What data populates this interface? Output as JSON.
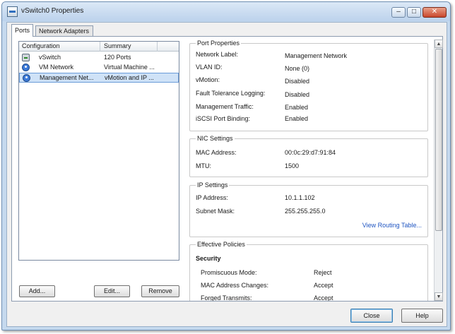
{
  "window": {
    "title": "vSwitch0 Properties"
  },
  "title_buttons": {
    "minimize": "–",
    "maximize": "□",
    "close": "✕"
  },
  "tabs": [
    "Ports",
    "Network Adapters"
  ],
  "list": {
    "columns": [
      "Configuration",
      "Summary"
    ],
    "rows": [
      {
        "name": "vSwitch",
        "summary": "120 Ports",
        "icon": "vswitch-icon"
      },
      {
        "name": "VM Network",
        "summary": "Virtual Machine ...",
        "icon": "network-icon"
      },
      {
        "name": "Management Net...",
        "summary": "vMotion and IP ...",
        "icon": "network-icon",
        "selected": true
      }
    ]
  },
  "list_buttons": {
    "add": "Add...",
    "edit": "Edit...",
    "remove": "Remove"
  },
  "port_properties": {
    "title": "Port Properties",
    "rows": [
      {
        "label": "Network Label:",
        "value": "Management Network"
      },
      {
        "label": "VLAN ID:",
        "value": "None (0)"
      },
      {
        "label": "vMotion:",
        "value": "Disabled"
      },
      {
        "label": "Fault Tolerance Logging:",
        "value": "Disabled"
      },
      {
        "label": "Management Traffic:",
        "value": "Enabled"
      },
      {
        "label": "iSCSI Port Binding:",
        "value": "Enabled"
      }
    ]
  },
  "nic_settings": {
    "title": "NIC Settings",
    "rows": [
      {
        "label": "MAC Address:",
        "value": "00:0c:29:d7:91:84"
      },
      {
        "label": "MTU:",
        "value": "1500"
      }
    ]
  },
  "ip_settings": {
    "title": "IP Settings",
    "rows": [
      {
        "label": "IP Address:",
        "value": "10.1.1.102"
      },
      {
        "label": "Subnet Mask:",
        "value": "255.255.255.0"
      }
    ],
    "link": "View Routing Table..."
  },
  "effective_policies": {
    "title": "Effective Policies",
    "section": "Security",
    "rows": [
      {
        "label": "Promiscuous Mode:",
        "value": "Reject"
      },
      {
        "label": "MAC Address Changes:",
        "value": "Accept"
      },
      {
        "label": "Forged Transmits:",
        "value": "Accept"
      }
    ]
  },
  "scrollbar": {
    "up": "▲",
    "down": "▼"
  },
  "footer": {
    "close": "Close",
    "help": "Help"
  },
  "colors": {
    "selection": "#cfe2f7",
    "link": "#1f55c2",
    "titlebar": "#c5d9ee"
  }
}
